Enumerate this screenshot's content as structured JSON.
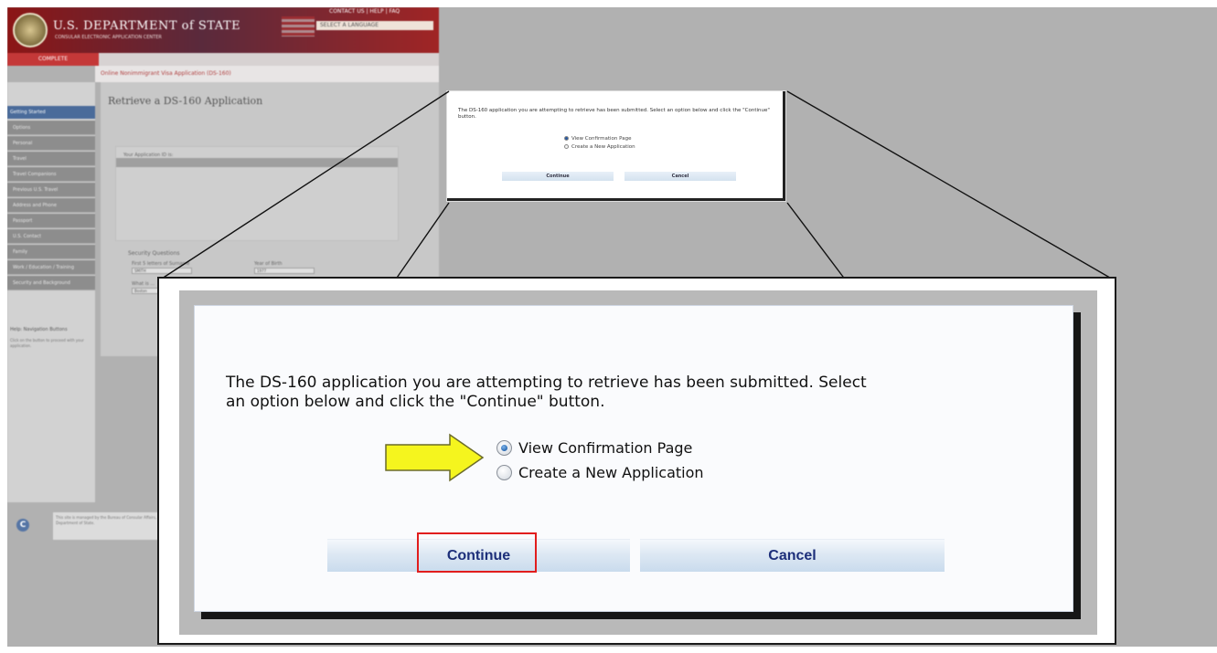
{
  "site": {
    "title": "U.S. DEPARTMENT of STATE",
    "subtitle": "CONSULAR ELECTRONIC APPLICATION CENTER",
    "top_links": "CONTACT US | HELP | FAQ",
    "language_select": "SELECT A LANGUAGE",
    "progress_active": "COMPLETE",
    "breadcrumb": "Online Nonimmigrant Visa Application (DS-160)",
    "page_title": "Retrieve a DS-160 Application",
    "nav_items": [
      "Getting Started",
      "Options",
      "Personal",
      "Travel",
      "Travel Companions",
      "Previous U.S. Travel",
      "Address and Phone",
      "Passport",
      "U.S. Contact",
      "Family",
      "Work / Education / Training",
      "Security and Background"
    ],
    "application_id_label": "Your Application ID is:",
    "security_heading": "Security Questions",
    "q1_label": "First 5 letters of Surname",
    "q1_value": "SMITH",
    "q2_label": "Year of Birth",
    "q2_value": "1977",
    "q3_label": "What is ...",
    "q3_value": "Boston",
    "help_heading": "Help: Navigation Buttons",
    "help_text": "Click on the button to proceed with your application.",
    "footer_text": "This site is managed by the Bureau of Consular Affairs, U.S. Department of State."
  },
  "small_dialog": {
    "message": "The DS-160 application you are attempting to retrieve has been submitted. Select an option below and click the \"Continue\" button.",
    "options": [
      "View Confirmation Page",
      "Create a New Application"
    ],
    "continue_label": "Continue",
    "cancel_label": "Cancel"
  },
  "dialog": {
    "message": " The DS-160 application you are attempting to retrieve has been submitted. Select\nan option below and click the \"Continue\" button.",
    "options": [
      {
        "label": "View Confirmation Page",
        "selected": true
      },
      {
        "label": "Create a New Application",
        "selected": false
      }
    ],
    "continue_label": "Continue",
    "cancel_label": "Cancel"
  },
  "colors": {
    "highlight_border": "#e11d1d",
    "arrow_fill": "#f5f51e",
    "button_text": "#1d2f7a",
    "site_header": "#8c1616"
  },
  "icons": {
    "arrow": "yellow-arrow-icon",
    "seal": "state-department-seal-icon"
  }
}
